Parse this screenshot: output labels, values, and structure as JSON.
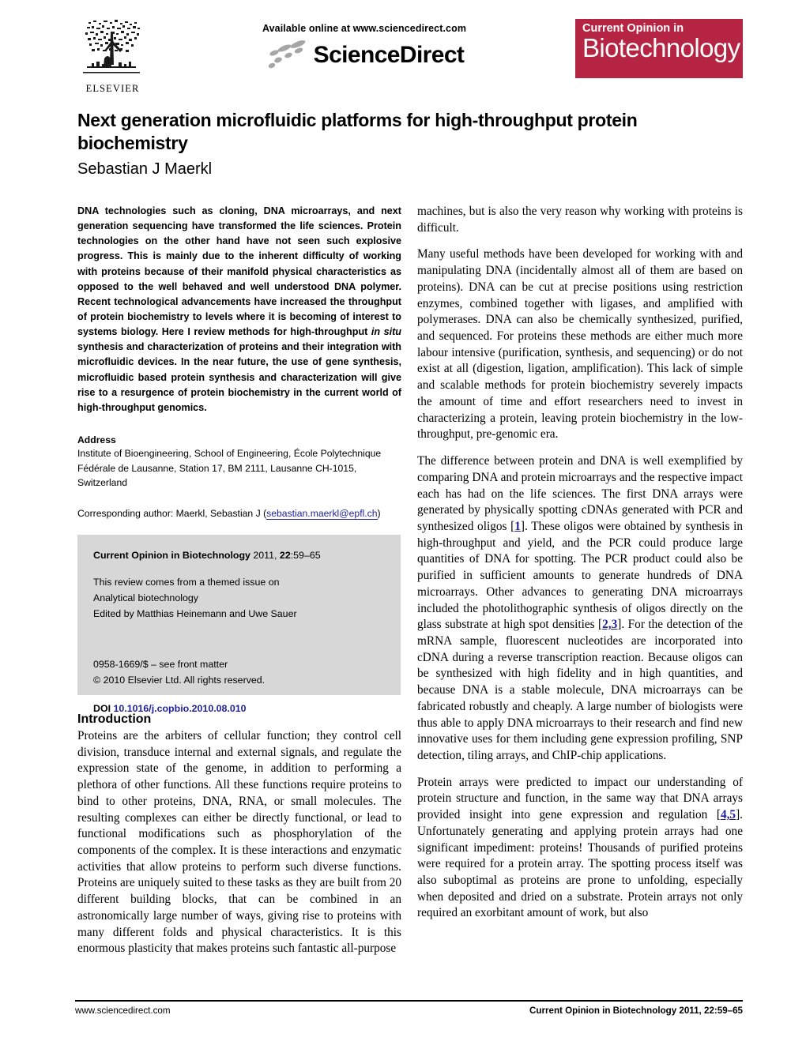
{
  "masthead": {
    "available_online": "Available online at www.sciencedirect.com",
    "sciencedirect_word": "ScienceDirect",
    "elsevier_word": "ELSEVIER",
    "journal_logo_top": "Current Opinion in",
    "journal_logo_main": "Biotechnology",
    "journal_logo_color": "#b52543"
  },
  "article": {
    "title": "Next generation microfluidic platforms for high-throughput protein biochemistry",
    "author": "Sebastian J Maerkl"
  },
  "abstract": {
    "part1": "DNA technologies such as cloning, DNA microarrays, and next generation sequencing have transformed the life sciences. Protein technologies on the other hand have not seen such explosive progress. This is mainly due to the inherent difficulty of working with proteins because of their manifold physical characteristics as opposed to the well behaved and well understood DNA polymer. Recent technological advancements have increased the throughput of protein biochemistry to levels where it is becoming of interest to systems biology. Here I review methods for high-throughput ",
    "italic1": "in situ",
    "part2": " synthesis and characterization of proteins and their integration with microfluidic devices. In the near future, the use of gene synthesis, microfluidic based protein synthesis and characterization will give rise to a resurgence of protein biochemistry in the current world of high-throughput genomics."
  },
  "address": {
    "heading": "Address",
    "body": "Institute of Bioengineering, School of Engineering, École Polytechnique Fédérale de Lausanne, Station 17, BM 2111, Lausanne CH-1015, Switzerland",
    "corresponding_prefix": "Corresponding author: Maerkl, Sebastian J (",
    "corresponding_email": "sebastian.maerkl@epfl.ch",
    "corresponding_suffix": ")"
  },
  "infobox": {
    "journal_name": "Current Opinion in Biotechnology",
    "journal_citation": " 2011, ",
    "volume": "22",
    "pages": ":59–65",
    "themed_line1": "This review comes from a themed issue on",
    "themed_line2": "Analytical biotechnology",
    "themed_line3": "Edited by Matthias Heinemann and Uwe Sauer",
    "issn_line": "0958-1669/$ – see front matter",
    "copyright_line": "© 2010 Elsevier Ltd. All rights reserved.",
    "doi_label": "DOI ",
    "doi_value": "10.1016/j.copbio.2010.08.010"
  },
  "introduction": {
    "heading": "Introduction",
    "paragraph_1_left": "Proteins are the arbiters of cellular function; they control cell division, transduce internal and external signals, and regulate the expression state of the genome, in addition to performing a plethora of other functions. All these functions require proteins to bind to other proteins, DNA, RNA, or small molecules. The resulting complexes can either be directly functional, or lead to functional modifications such as phosphorylation of the components of the complex. It is these interactions and enzymatic activities that allow proteins to perform such diverse functions. Proteins are uniquely suited to these tasks as they are built from 20 different building blocks, that can be combined in an astronomically large number of ways, giving rise to proteins with many different folds and physical characteristics. It is this enormous plasticity that makes proteins such fantastic all-purpose"
  },
  "right_column": {
    "paragraph_1": "machines, but is also the very reason why working with proteins is difficult.",
    "paragraph_2": "Many useful methods have been developed for working with and manipulating DNA (incidentally almost all of them are based on proteins). DNA can be cut at precise positions using restriction enzymes, combined together with ligases, and amplified with polymerases. DNA can also be chemically synthesized, purified, and sequenced. For proteins these methods are either much more labour intensive (purification, synthesis, and sequencing) or do not exist at all (digestion, ligation, amplification). This lack of simple and scalable methods for protein biochemistry severely impacts the amount of time and effort researchers need to invest in characterizing a protein, leaving protein biochemistry in the low-throughput, pre-genomic era.",
    "paragraph_3a": "The difference between protein and DNA is well exemplified by comparing DNA and protein microarrays and the respective impact each has had on the life sciences. The first DNA arrays were generated by physically spotting cDNAs generated with PCR and synthesized oligos [",
    "paragraph_3_ref1": "1",
    "paragraph_3b": "]. These oligos were obtained by synthesis in high-throughput and yield, and the PCR could produce large quantities of DNA for spotting. The PCR product could also be purified in sufficient amounts to generate hundreds of DNA microarrays. Other advances to generating DNA microarrays included the photolithographic synthesis of oligos directly on the glass substrate at high spot densities [",
    "paragraph_3_ref2": "2,3",
    "paragraph_3c": "]. For the detection of the mRNA sample, fluorescent nucleotides are incorporated into cDNA during a reverse transcription reaction. Because oligos can be synthesized with high fidelity and in high quantities, and because DNA is a stable molecule, DNA microarrays can be fabricated robustly and cheaply. A large number of biologists were thus able to apply DNA microarrays to their research and find new innovative uses for them including gene expression profiling, SNP detection, tiling arrays, and ChIP-chip applications.",
    "paragraph_4a": "Protein arrays were predicted to impact our understanding of protein structure and function, in the same way that DNA arrays provided insight into gene expression and regulation [",
    "paragraph_4_ref": "4,5",
    "paragraph_4b": "]. Unfortunately generating and applying protein arrays had one significant impediment: proteins! Thousands of purified proteins were required for a protein array. The spotting process itself was also suboptimal as proteins are prone to unfolding, especially when deposited and dried on a substrate. Protein arrays not only required an exorbitant amount of work, but also"
  },
  "footer": {
    "left": "www.sciencedirect.com",
    "right": "Current Opinion in Biotechnology 2011, 22:59–65"
  }
}
